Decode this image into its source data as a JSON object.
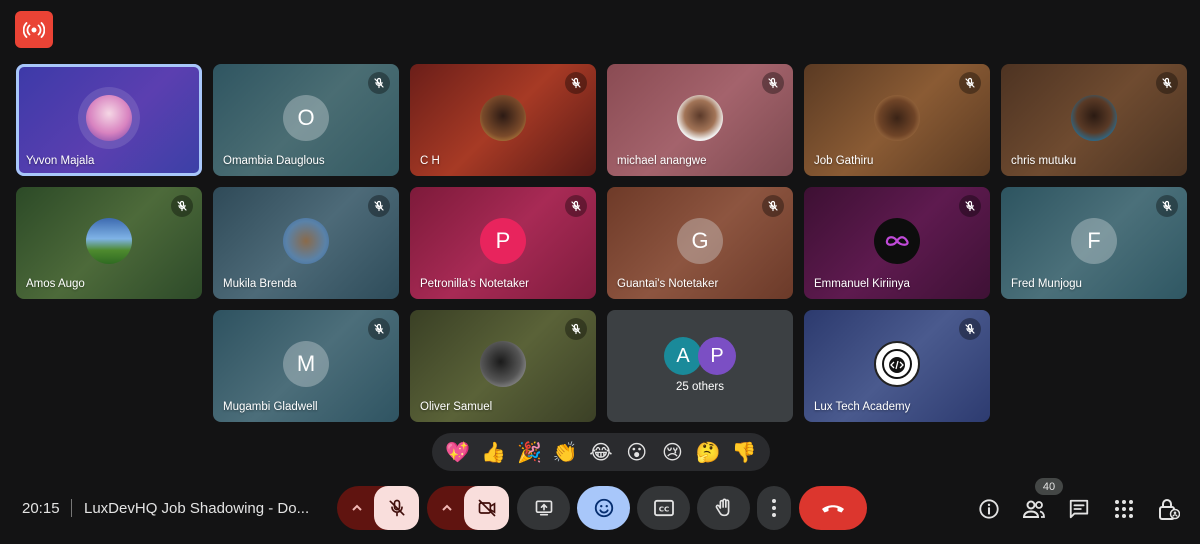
{
  "participants": [
    {
      "name": "Yvvon Majala",
      "type": "photo",
      "active": true,
      "bg": "linear-gradient(135deg,#3c3aa8,#5b3fb0 55%,#3a40a6)",
      "avatar_bg": "radial-gradient(circle at 50% 40%,#f5d7e5,#d883c0 55%,#6d3fa8)"
    },
    {
      "name": "Omambia Dauglous",
      "type": "letter",
      "letter": "O",
      "bg": "linear-gradient(135deg,#2f5561,#4a6d73 50%,#345a63)"
    },
    {
      "name": "C H",
      "type": "photo",
      "bg": "linear-gradient(135deg,#6b1e19,#a73a25 50%,#5a1a16)",
      "avatar_bg": "radial-gradient(circle at 50% 45%,#2c1a14,#7a4a2a 60%,#e2a84b)"
    },
    {
      "name": "michael anangwe",
      "type": "photo",
      "bg": "linear-gradient(135deg,#8a4b53,#a4636c 50%,#7d4a50)",
      "avatar_bg": "radial-gradient(circle at 50% 45%,#5b3a2a,#a27457 45%,#f1f1f1 70%)"
    },
    {
      "name": "Job Gathiru",
      "type": "photo",
      "bg": "linear-gradient(135deg,#5a3a23,#8a5b34 50%,#5a3a22)",
      "avatar_bg": "radial-gradient(circle at 50% 50%,#3a2316,#6f4427 55%,#c8935a)"
    },
    {
      "name": "chris mutuku",
      "type": "photo",
      "bg": "linear-gradient(135deg,#4d3322,#6f4b30 50%,#4a3322)",
      "avatar_bg": "radial-gradient(circle at 50% 45%,#2a1a12,#5a3a26 50%,#2c6a8a 75%)"
    },
    {
      "name": "Amos Augo",
      "type": "photo",
      "bg": "linear-gradient(135deg,#2c4a27,#4d6a3a 50%,#2d4a29)",
      "avatar_bg": "linear-gradient(180deg,#3d6ab0 0%,#7fb3e6 45%,#4e8a2e 70%,#2f6a22 100%)"
    },
    {
      "name": "Mukila Brenda",
      "type": "photo",
      "bg": "linear-gradient(135deg,#2f4a58,#4d6a78 50%,#2e4c5a)",
      "avatar_bg": "radial-gradient(circle at 50% 50%,#8a6a4a,#5a82a8 60%,#3a6aa0)"
    },
    {
      "name": "Petronilla's Notetaker",
      "type": "letter",
      "letter": "P",
      "bg": "linear-gradient(135deg,#7d1a3a,#a82a55 50%,#7e1c3d)",
      "avatar_color": "#e8245d"
    },
    {
      "name": "Guantai's Notetaker",
      "type": "letter",
      "letter": "G",
      "bg": "linear-gradient(135deg,#6e3a28,#8d5540 50%,#6b3a29)"
    },
    {
      "name": "Emmanuel Kiriinya",
      "type": "photo",
      "bg": "linear-gradient(135deg,#3d1033,#5e1a4f 50%,#3e1135)",
      "avatar_bg": "#0d0d0d"
    },
    {
      "name": "Fred Munjogu",
      "type": "letter",
      "letter": "F",
      "bg": "linear-gradient(135deg,#2d5460,#4b707a 50%,#2f5763)"
    },
    {
      "name": "Mugambi Gladwell",
      "type": "letter",
      "letter": "M",
      "bg": "linear-gradient(135deg,#2e5260,#4c6e7a 50%,#2f5462)"
    },
    {
      "name": "Oliver Samuel",
      "type": "photo",
      "bg": "linear-gradient(135deg,#3a4025,#5a6238 50%,#3b4026)",
      "avatar_bg": "radial-gradient(circle at 45% 45%,#1a1a1a,#555 55%,#bbb)"
    },
    {
      "name": "Lux Tech Academy",
      "type": "photo",
      "bg": "linear-gradient(135deg,#2c3a6e,#4a5a8e 50%,#2d3b70)",
      "avatar_bg": "#ffffff"
    }
  ],
  "others": {
    "label": "25 others",
    "avatars": [
      {
        "letter": "A",
        "color": "#1a8a9a"
      },
      {
        "letter": "P",
        "color": "#7b4fc4"
      }
    ]
  },
  "reactions": [
    "💖",
    "👍",
    "🎉",
    "👏",
    "😂",
    "😮",
    "😢",
    "🤔",
    "👎"
  ],
  "meeting": {
    "time": "20:15",
    "title": "LuxDevHQ Job Shadowing - Do..."
  },
  "people_count": "40",
  "colors": {
    "accent": "#a8c7fa",
    "end_call": "#dc362e",
    "mic_off_bg": "#f9dedc",
    "muted_group": "#601410"
  }
}
